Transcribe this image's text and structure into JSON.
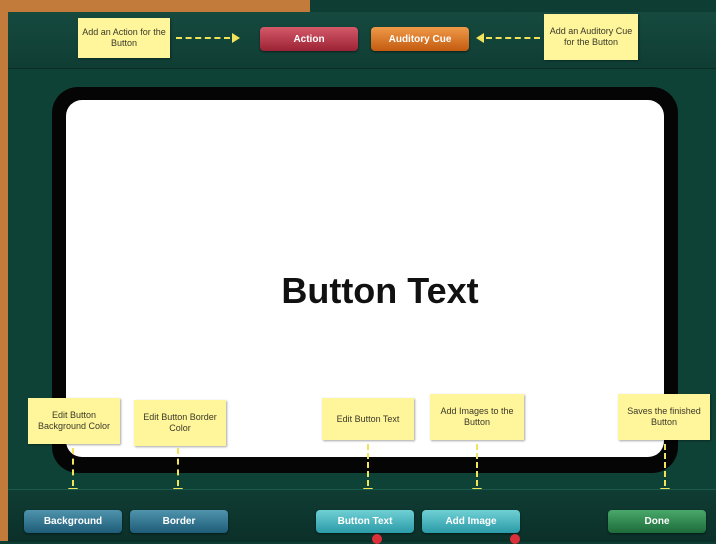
{
  "top_notes": {
    "action": "Add an Action for the Button",
    "cue": "Add an Auditory Cue for the Button"
  },
  "top_buttons": {
    "action": "Action",
    "cue": "Auditory Cue"
  },
  "preview": {
    "button_text": "Button Text"
  },
  "bottom_notes": {
    "background": "Edit Button Background Color",
    "border": "Edit Button Border Color",
    "text": "Edit Button Text",
    "image": "Add Images to the Button",
    "done": "Saves the finished Button"
  },
  "bottom_buttons": {
    "background": "Background",
    "border": "Border",
    "text": "Button Text",
    "image": "Add Image",
    "done": "Done"
  },
  "colors": {
    "background": "#0e3d33",
    "note": "#fff59a",
    "arrow": "#f2e45a",
    "action": "#b3394a",
    "cue": "#d9752a",
    "done": "#2f8a52"
  }
}
